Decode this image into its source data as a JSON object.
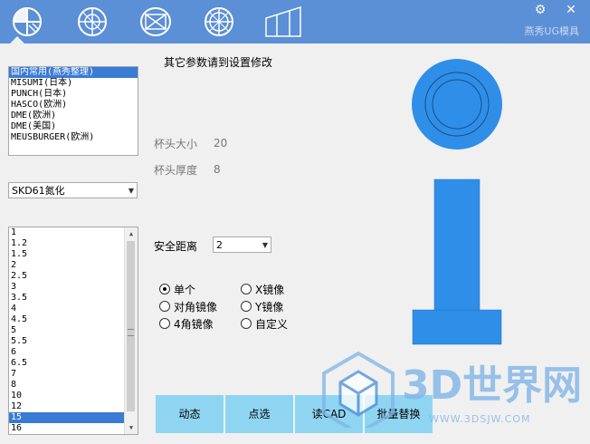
{
  "topbar": {
    "tabs": [
      {
        "icon": "circle-sector-icon"
      },
      {
        "icon": "circle-crosshair-icon"
      },
      {
        "icon": "rect-cross-icon"
      },
      {
        "icon": "circle-grid-icon"
      },
      {
        "icon": "plate-slant-icon"
      }
    ],
    "settings_glyph": "⚙",
    "close_glyph": "✕",
    "brand": "燕秀UG模具"
  },
  "caption": "其它参数请到设置修改",
  "standards": {
    "items": [
      "国内常用(燕秀整理)",
      "MISUMI(日本)",
      "PUNCH(日本)",
      "HASCO(欧洲)",
      "DME(欧洲)",
      "DME(美国)",
      "MEUSBURGER(欧洲)"
    ],
    "selected_index": 0
  },
  "material": {
    "value": "SKD61氮化"
  },
  "sizes": {
    "items": [
      "1",
      "1.2",
      "1.5",
      "2",
      "2.5",
      "3",
      "3.5",
      "4",
      "4.5",
      "5",
      "5.5",
      "6",
      "6.5",
      "7",
      "8",
      "10",
      "12",
      "15",
      "16"
    ],
    "selected_index": 17
  },
  "params": {
    "cup_size_label": "杯头大小",
    "cup_size_value": "20",
    "cup_thickness_label": "杯头厚度",
    "cup_thickness_value": "8",
    "safe_distance_label": "安全距离",
    "safe_distance_value": "2"
  },
  "mirror": {
    "options": [
      {
        "label": "单个",
        "checked": true
      },
      {
        "label": "X镜像",
        "checked": false
      },
      {
        "label": "对角镜像",
        "checked": false
      },
      {
        "label": "Y镜像",
        "checked": false
      },
      {
        "label": "4角镜像",
        "checked": false
      },
      {
        "label": "自定义",
        "checked": false
      }
    ]
  },
  "buttons": [
    "动态",
    "点选",
    "读CAD",
    "批量替换"
  ],
  "watermark": {
    "text": "3D世界网",
    "url": "WWW.3DSJW.COM"
  },
  "colors": {
    "accent": "#5b8fd6",
    "part": "#2f8fe8",
    "button": "#8fd5f2",
    "selection": "#3a7bd5"
  }
}
